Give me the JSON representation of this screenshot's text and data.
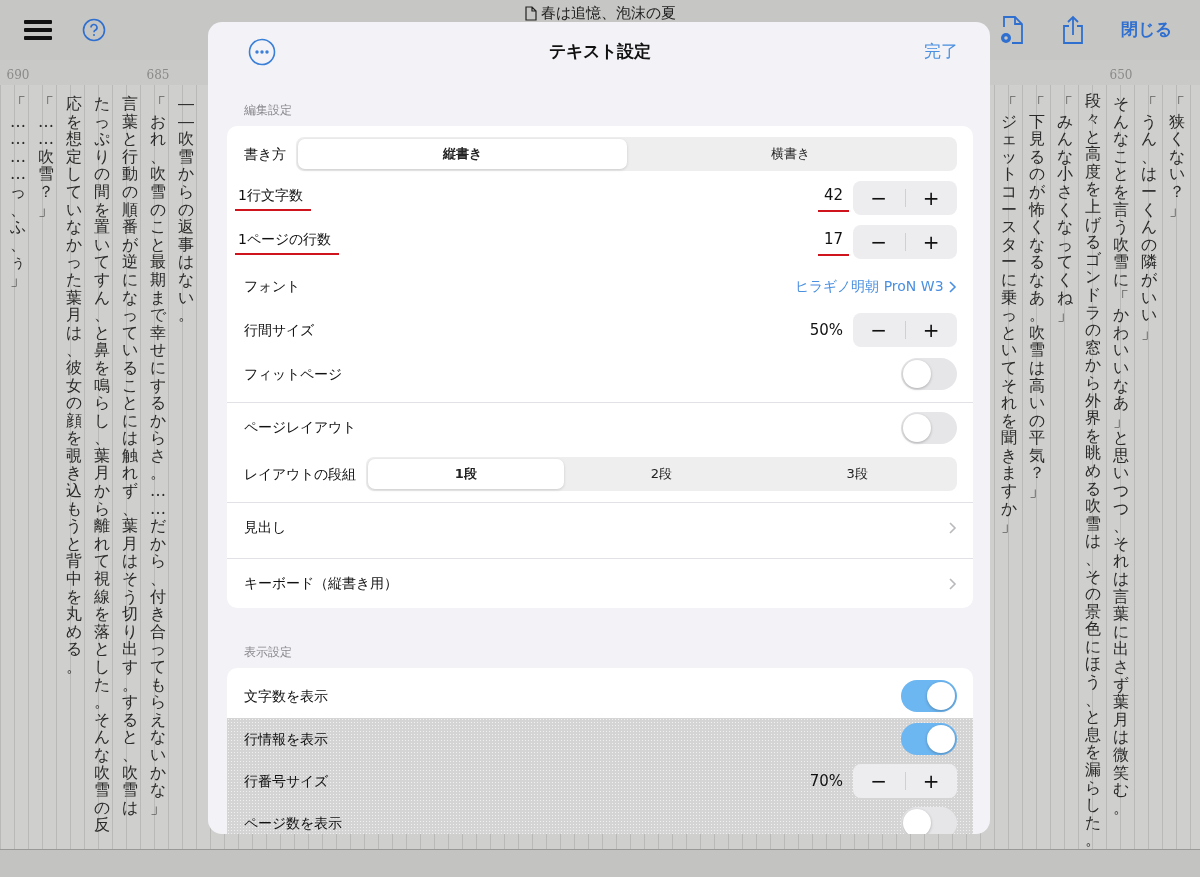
{
  "top_bar": {
    "document_title": "春は追憶、泡沫の夏",
    "close_label": "閉じる"
  },
  "manuscript": {
    "left_columns": [
      {
        "line_number": "690",
        "text": "「…………っ、ふ、ぅ」"
      },
      {
        "text": "「……吹雪？」"
      },
      {
        "text": "応を想定していなかった葉月は、彼女の顔を覗き込もうと背中を丸める。"
      },
      {
        "text": "たっぷりの間を置いてすん、と鼻を鳴らし、葉月から離れて視線を落とした。そんな吹雪の反"
      },
      {
        "text": "言葉と行動の順番が逆になっていることには触れず、葉月はそう切り出す。すると、吹雪は"
      },
      {
        "line_number": "685",
        "text": "「おれ、吹雪のこと最期まで幸せにするからさ。……だから、付き合ってもらえないかな」"
      },
      {
        "text": "――吹雪からの返事はない。"
      }
    ],
    "right_columns": [
      {
        "text": "「ジェットコースターに乗っといてそれを聞きますか」"
      },
      {
        "text": "「下見るのが怖くなるなあ。吹雪は高いの平気？」"
      },
      {
        "text": "「みんな小さくなってくね」"
      },
      {
        "text": "段々と高度を上げるゴンドラの窓から外界を眺める吹雪は、その景色にほう、と息を漏らした。"
      },
      {
        "line_number": "650",
        "text": "そんなことを言う吹雪に「かわいいなあ」と思いつつ、それは言葉に出さず葉月は微笑む。"
      },
      {
        "text": "「うん、はーくんの隣がいい」"
      },
      {
        "text": "「狭くない？」"
      }
    ]
  },
  "sheet": {
    "title": "テキスト設定",
    "done_label": "完了",
    "sections": [
      {
        "heading": "編集設定",
        "rows": [
          {
            "kind": "segmented",
            "label": "書き方",
            "options": [
              {
                "label": "縦書き",
                "selected": true
              },
              {
                "label": "横書き",
                "selected": false
              }
            ]
          },
          {
            "kind": "stepper",
            "label": "1行文字数",
            "value": "42",
            "decrement": "−",
            "increment": "+",
            "marked": true
          },
          {
            "kind": "stepper",
            "label": "1ページの行数",
            "value": "17",
            "decrement": "−",
            "increment": "+",
            "marked": true
          },
          {
            "kind": "link",
            "label": "フォント",
            "value": "ヒラギノ明朝 ProN W3"
          },
          {
            "kind": "stepper",
            "label": "行間サイズ",
            "value": "50%",
            "decrement": "−",
            "increment": "+"
          },
          {
            "kind": "toggle",
            "label": "フィットページ",
            "on": false
          },
          {
            "kind": "toggle",
            "label": "ページレイアウト",
            "on": false,
            "divider_above": true
          },
          {
            "kind": "segmented",
            "label": "レイアウトの段組",
            "options": [
              {
                "label": "1段",
                "selected": true
              },
              {
                "label": "2段",
                "selected": false
              },
              {
                "label": "3段",
                "selected": false
              }
            ]
          },
          {
            "kind": "nav",
            "label": "見出し",
            "divider_above": true
          },
          {
            "kind": "nav",
            "label": "キーボード（縦書き用）",
            "divider_above": true
          }
        ]
      },
      {
        "heading": "表示設定",
        "rows": [
          {
            "kind": "toggle",
            "label": "文字数を表示",
            "on": true
          },
          {
            "kind": "toggle",
            "label": "行情報を表示",
            "on": true,
            "shaded": true
          },
          {
            "kind": "stepper",
            "label": "行番号サイズ",
            "value": "70%",
            "decrement": "−",
            "increment": "+",
            "shaded": true
          },
          {
            "kind": "toggle",
            "label": "ページ数を表示",
            "on": false,
            "shaded": true
          }
        ]
      }
    ]
  }
}
